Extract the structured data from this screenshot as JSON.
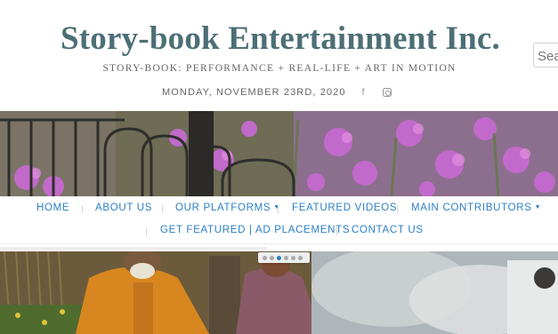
{
  "header": {
    "site_title": "Story-book Entertainment Inc.",
    "tagline": "STORY-BOOK: PERFORMANCE + REAL-LIFE + ART IN MOTION",
    "date": "MONDAY, NOVEMBER 23RD, 2020",
    "social": [
      {
        "icon": "facebook-icon",
        "glyph": "f"
      },
      {
        "icon": "instagram-icon"
      }
    ],
    "search": {
      "placeholder": "Search"
    }
  },
  "nav": {
    "items": [
      {
        "label": "HOME"
      },
      {
        "label": "ABOUT US"
      },
      {
        "label": "OUR PLATFORMS",
        "dropdown": true
      },
      {
        "label": "FEATURED VIDEOS"
      },
      {
        "label": "MAIN CONTRIBUTORS",
        "dropdown": true
      },
      {
        "label": "GET FEATURED | AD PLACEMENTS"
      },
      {
        "label": "CONTACT US"
      }
    ],
    "caret": "▼"
  },
  "slider": {
    "dot_count": 6,
    "active_index": 2
  },
  "colors": {
    "title": "#4d6f76",
    "nav_link": "#2c7fc6",
    "slider_active": "#2c7fc6"
  }
}
